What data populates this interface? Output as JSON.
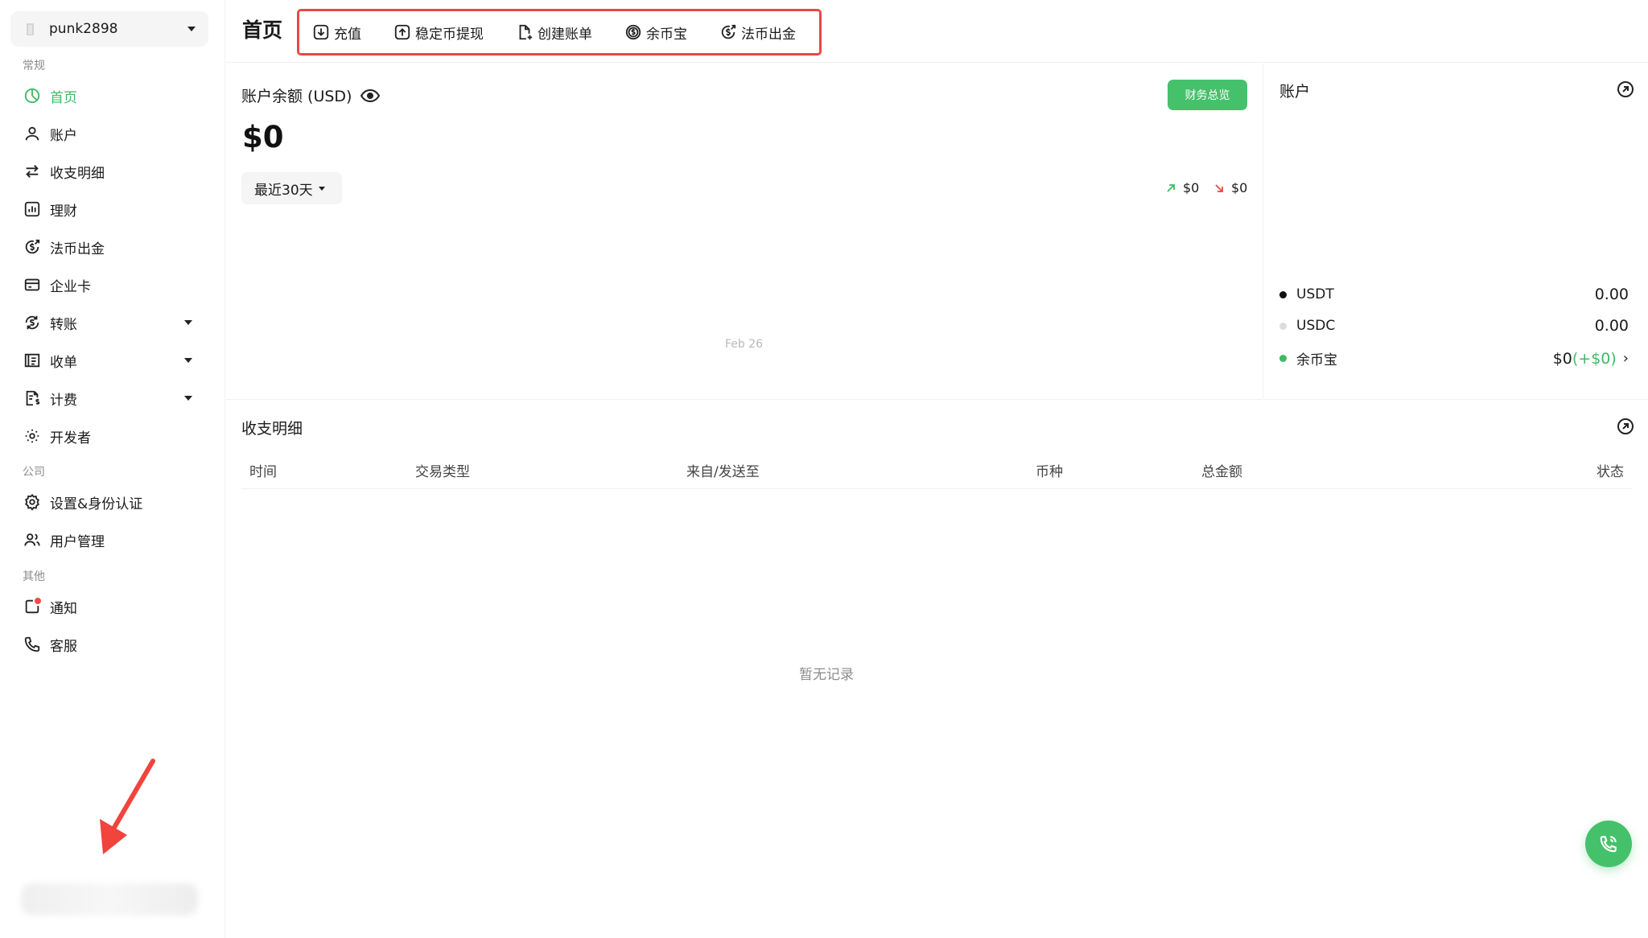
{
  "org": {
    "name": "punk2898"
  },
  "sidebar": {
    "sections": {
      "general": "常规",
      "company": "公司",
      "other": "其他"
    },
    "items": [
      {
        "key": "home",
        "label": "首页",
        "icon": "clock-pie-icon",
        "active": true
      },
      {
        "key": "account",
        "label": "账户",
        "icon": "user-icon"
      },
      {
        "key": "transactions",
        "label": "收支明细",
        "icon": "swap-arrows-icon"
      },
      {
        "key": "wealth",
        "label": "理财",
        "icon": "bar-chart-icon"
      },
      {
        "key": "fiat_offramp",
        "label": "法币出金",
        "icon": "dollar-coin-out-icon"
      },
      {
        "key": "corp_card",
        "label": "企业卡",
        "icon": "credit-card-icon"
      },
      {
        "key": "transfer",
        "label": "转账",
        "icon": "dollar-cycle-icon",
        "expandable": true
      },
      {
        "key": "collect",
        "label": "收单",
        "icon": "receipt-icon",
        "expandable": true
      },
      {
        "key": "billing",
        "label": "计费",
        "icon": "invoice-dollar-icon",
        "expandable": true
      },
      {
        "key": "developer",
        "label": "开发者",
        "icon": "developer-gear-icon"
      },
      {
        "key": "settings",
        "label": "设置&身份认证",
        "icon": "gear-icon"
      },
      {
        "key": "users",
        "label": "用户管理",
        "icon": "users-icon"
      },
      {
        "key": "notifications",
        "label": "通知",
        "icon": "notification-icon",
        "badge_color": "#f04a4a"
      },
      {
        "key": "support",
        "label": "客服",
        "icon": "phone-icon"
      }
    ]
  },
  "header": {
    "title": "首页",
    "quick_actions": [
      {
        "label": "充值",
        "icon": "download-square-icon"
      },
      {
        "label": "稳定币提现",
        "icon": "upload-square-icon"
      },
      {
        "label": "创建账单",
        "icon": "file-plus-icon"
      },
      {
        "label": "余币宝",
        "icon": "dollar-circle-icon"
      },
      {
        "label": "法币出金",
        "icon": "dollar-coin-out-icon"
      }
    ],
    "highlight_color": "#e84848"
  },
  "balance": {
    "label": "账户余额 (USD)",
    "amount": "$0",
    "overview_button": "财务总览",
    "range": "最近30天",
    "inflow": "$0",
    "outflow": "$0",
    "chart_tick": "Feb 26"
  },
  "accounts": {
    "title": "账户",
    "rows": [
      {
        "name": "USDT",
        "value": "0.00",
        "dot_color": "#111111"
      },
      {
        "name": "USDC",
        "value": "0.00",
        "dot_color": "#dcdcdc"
      },
      {
        "name": "余币宝",
        "value": "$0",
        "extra": "(+$0)",
        "dot_color": "#3fb964"
      }
    ]
  },
  "transactions": {
    "title": "收支明细",
    "columns": [
      "时间",
      "交易类型",
      "来自/发送至",
      "币种",
      "总金额",
      "状态"
    ],
    "empty_text": "暂无记录"
  },
  "colors": {
    "accent": "#45c16b",
    "active_text": "#3fb964",
    "danger": "#e84848"
  }
}
